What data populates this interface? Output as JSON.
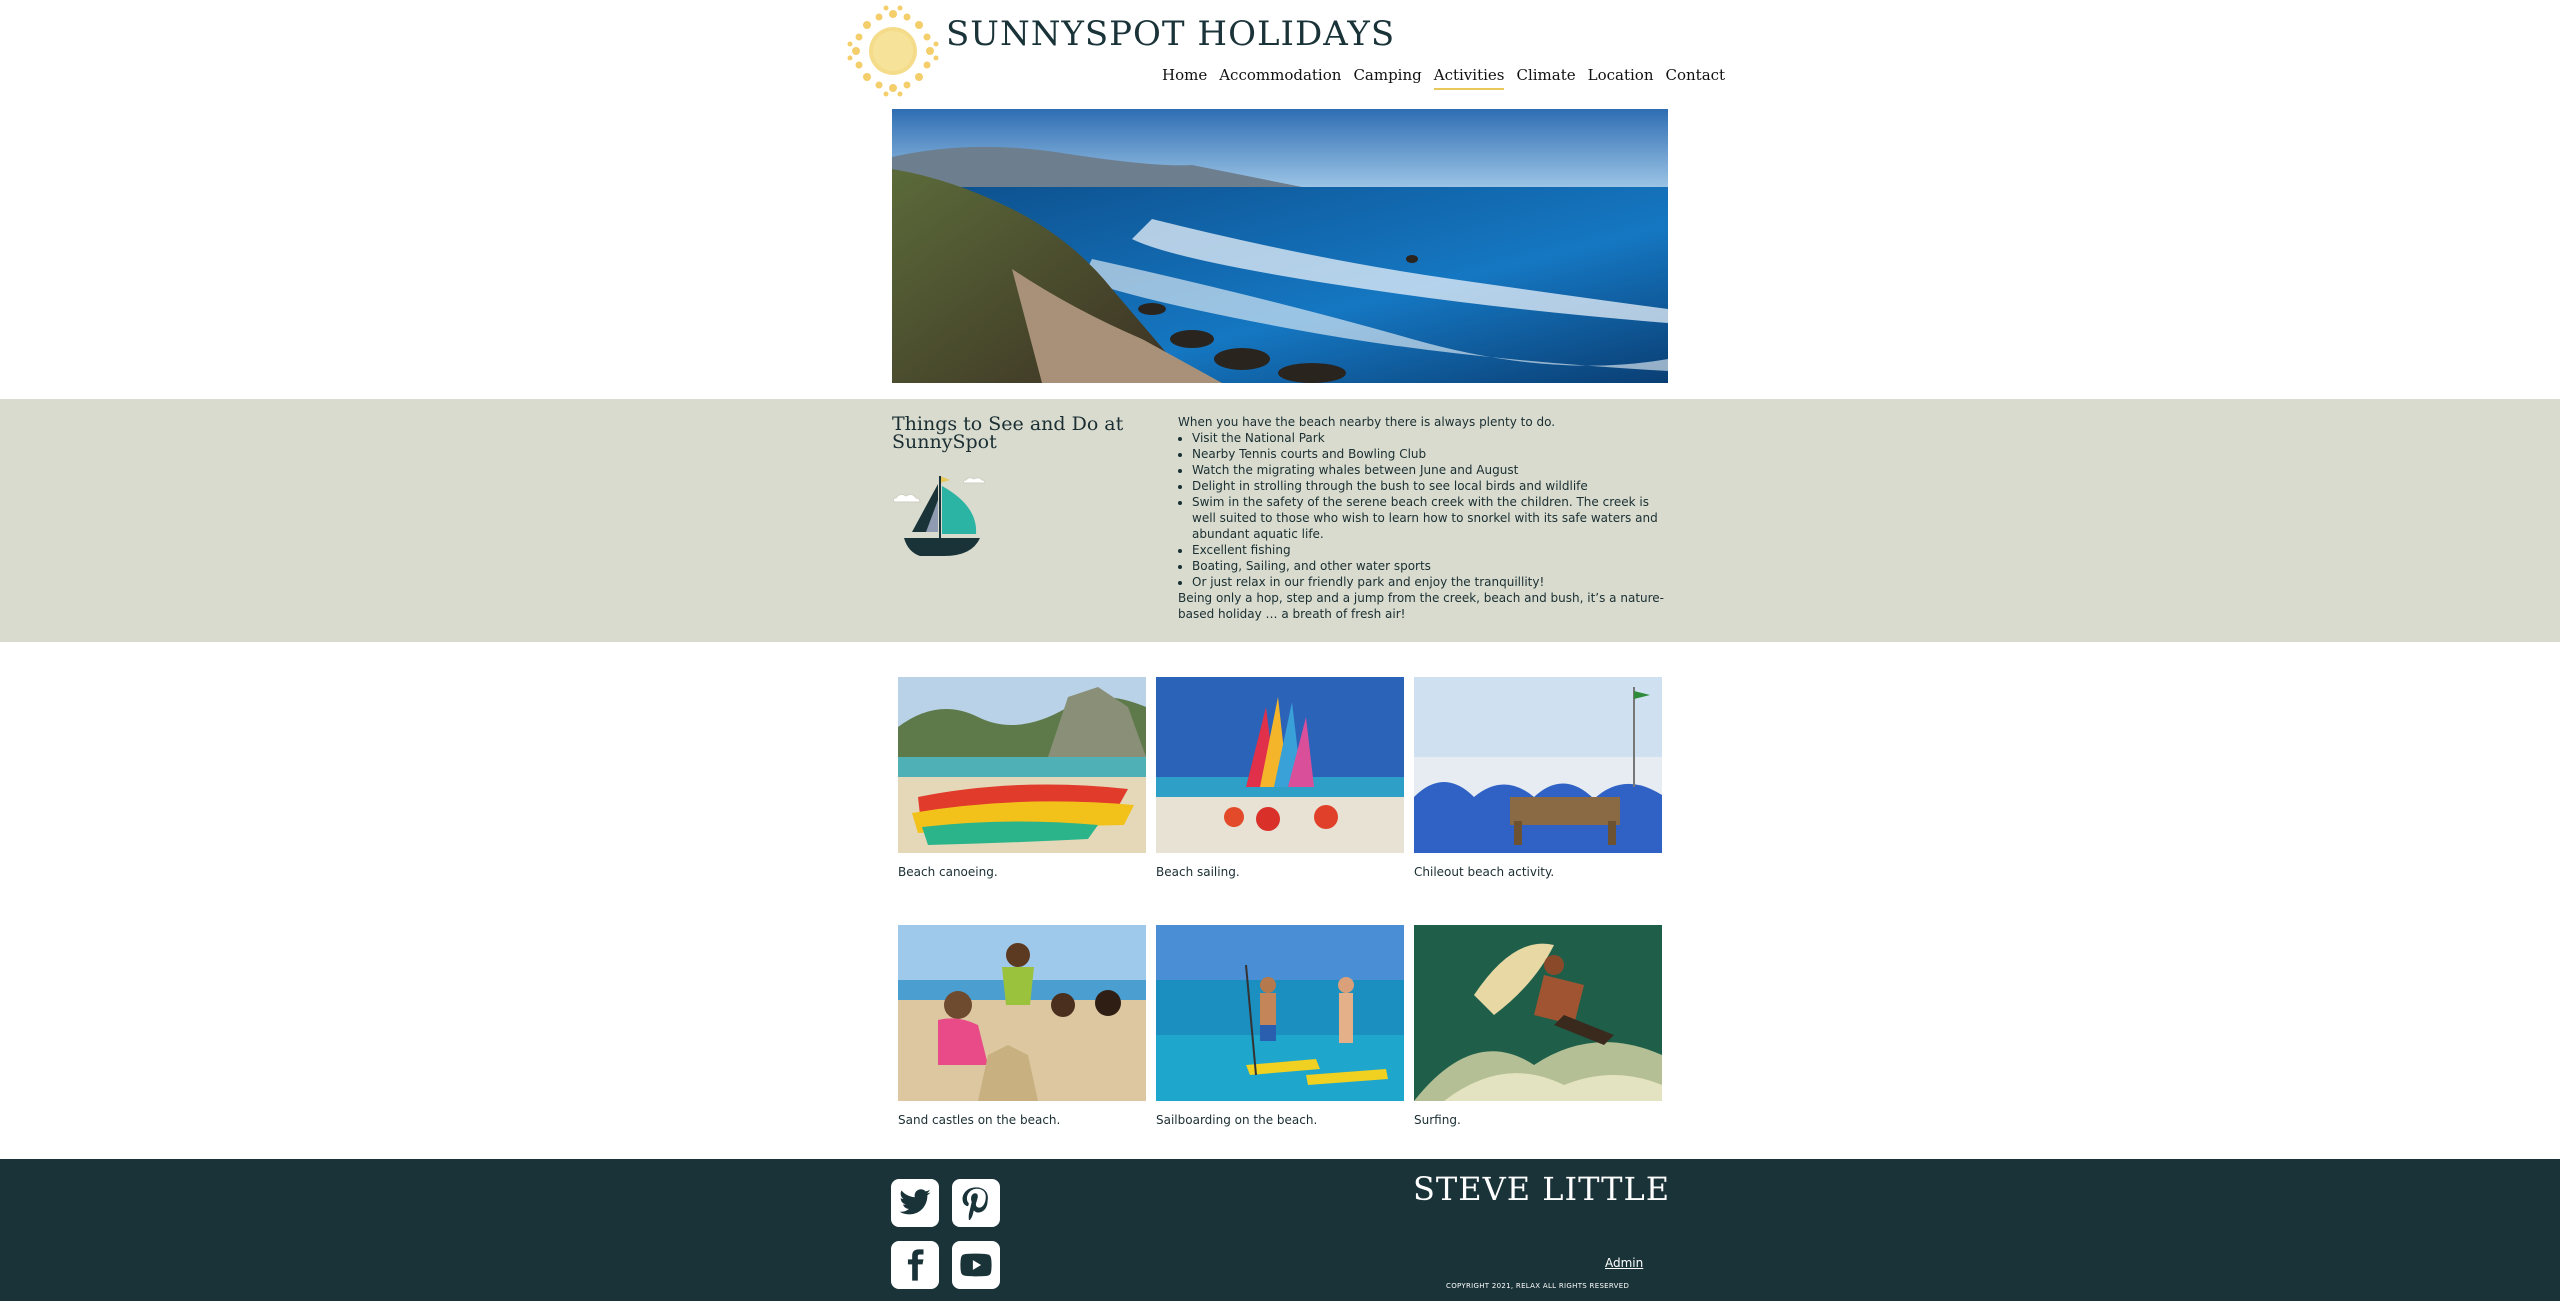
{
  "header": {
    "brand": "SUNNYSPOT HOLIDAYS",
    "nav": [
      "Home",
      "Accommodation",
      "Camping",
      "Activities",
      "Climate",
      "Location",
      "Contact"
    ],
    "active": "Activities"
  },
  "intro": {
    "title": "Things to See and Do at SunnySpot",
    "lead": "When you have the beach nearby there is always plenty to do.",
    "items": [
      "Visit the National Park",
      "Nearby Tennis courts and Bowling Club",
      "Watch the migrating whales between June and August",
      "Delight in strolling through the bush to see local birds and wildlife",
      "Swim in the safety of the serene beach creek with the children. The creek is well suited to those who wish to learn how to snorkel with its safe waters and abundant aquatic life.",
      "Excellent fishing",
      "Boating, Sailing, and other water sports",
      "Or just relax in our friendly park and enjoy the tranquillity!"
    ],
    "closing": "Being only a hop, step and a jump from the creek, beach and bush, it’s a nature-based holiday … a breath of fresh air!"
  },
  "gallery": [
    {
      "caption": "Beach canoeing."
    },
    {
      "caption": "Beach sailing."
    },
    {
      "caption": "Chileout beach activity."
    },
    {
      "caption": "Sand castles on the beach."
    },
    {
      "caption": "Sailboarding on the beach."
    },
    {
      "caption": "Surfing."
    }
  ],
  "footer": {
    "name": "STEVE LITTLE",
    "admin": "Admin",
    "copyright": "COPYRIGHT 2021, RELAX ALL RIGHTS RESERVED",
    "social_icons": [
      "twitter-icon",
      "pinterest-icon",
      "facebook-icon",
      "youtube-icon"
    ]
  },
  "colors": {
    "brand": "#1a3338",
    "band": "#d8dbcd",
    "accent": "#e8c85a"
  }
}
